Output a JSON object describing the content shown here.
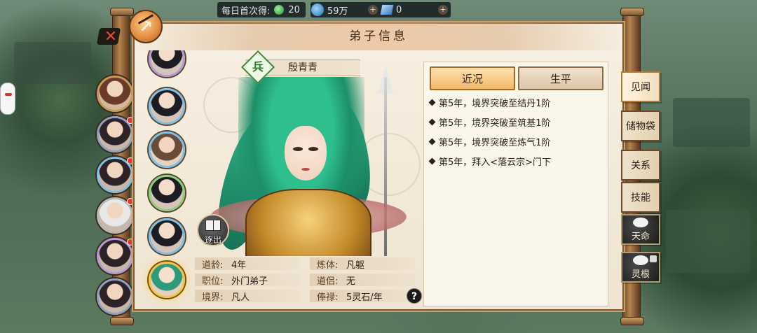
{
  "topbar": {
    "daily_label": "每日首次得:",
    "daily_value": "20",
    "resource1_value": "59万",
    "resource2_value": "0",
    "plus_symbol": "+"
  },
  "panel": {
    "title": "弟子信息",
    "corner_icon": "scroll-badge-icon"
  },
  "character": {
    "name": "殷青青",
    "class_char": "兵"
  },
  "expel": {
    "label": "逐出"
  },
  "stats": {
    "daoling_key": "道龄:",
    "daoling_val": "4年",
    "lianti_key": "炼体:",
    "lianti_val": "凡躯",
    "zhiwei_key": "职位:",
    "zhiwei_val": "外门弟子",
    "daolv_key": "道侣:",
    "daolv_val": "无",
    "jingjie_key": "境界:",
    "jingjie_val": "凡人",
    "fenglu_key": "俸禄:",
    "fenglu_val": "5灵石/年",
    "help": "?"
  },
  "tabs": {
    "recent": "近况",
    "life": "生平"
  },
  "events": [
    "第5年，境界突破至结丹1阶",
    "第5年，境界突破至筑基1阶",
    "第5年，境界突破至炼气1阶",
    "第5年，拜入<落云宗>门下"
  ],
  "side_menu": {
    "jianwen": "见闻",
    "chuwudai": "储物袋",
    "guanxi": "关系",
    "jineng": "技能",
    "tianming": "天命",
    "linggen": "灵根"
  },
  "colors": {
    "accent_tab": "#f2b96a",
    "selected_avatar": "#f2c54a",
    "class_badge": "#3d8a3c"
  }
}
